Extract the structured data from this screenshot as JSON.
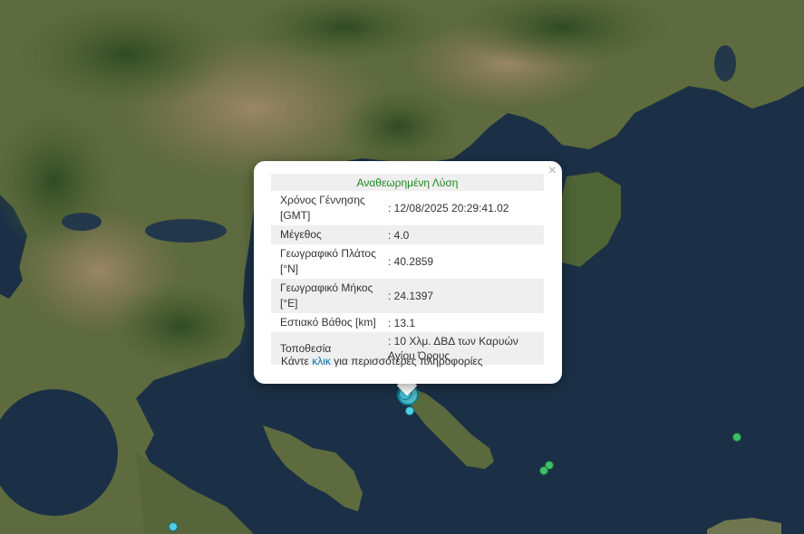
{
  "colors": {
    "sea": "#1b3046",
    "land": "#5e6b3e",
    "land_dry": "#8b7a5a",
    "mountain": "#3f5a2c",
    "quake_cyan": "#4fd0e6",
    "quake_green": "#3fbf6a",
    "popup_title": "#1e8a1e",
    "link": "#0078a8"
  },
  "popup": {
    "close_icon": "×",
    "title": "Αναθεωρημένη Λύση",
    "rows": [
      {
        "label": "Χρόνος Γέννησης [GMT]",
        "value": ": 12/08/2025 20:29:41.02"
      },
      {
        "label": "Μέγεθος",
        "value": ": 4.0"
      },
      {
        "label": "Γεωγραφικό Πλάτος [°N]",
        "value": ": 40.2859"
      },
      {
        "label": "Γεωγραφικό Μήκος [°E]",
        "value": ": 24.1397"
      },
      {
        "label": "Εστιακό Βάθος [km]",
        "value": ": 13.1"
      },
      {
        "label": "Τοποθεσία",
        "value": ": 10 Χλμ. ΔΒΔ των Καρυών Αγίου Όρους"
      }
    ],
    "more_prefix": "Κάντε ",
    "more_link": "κλικ",
    "more_suffix": " για περισσότερες πληροφορίες"
  }
}
